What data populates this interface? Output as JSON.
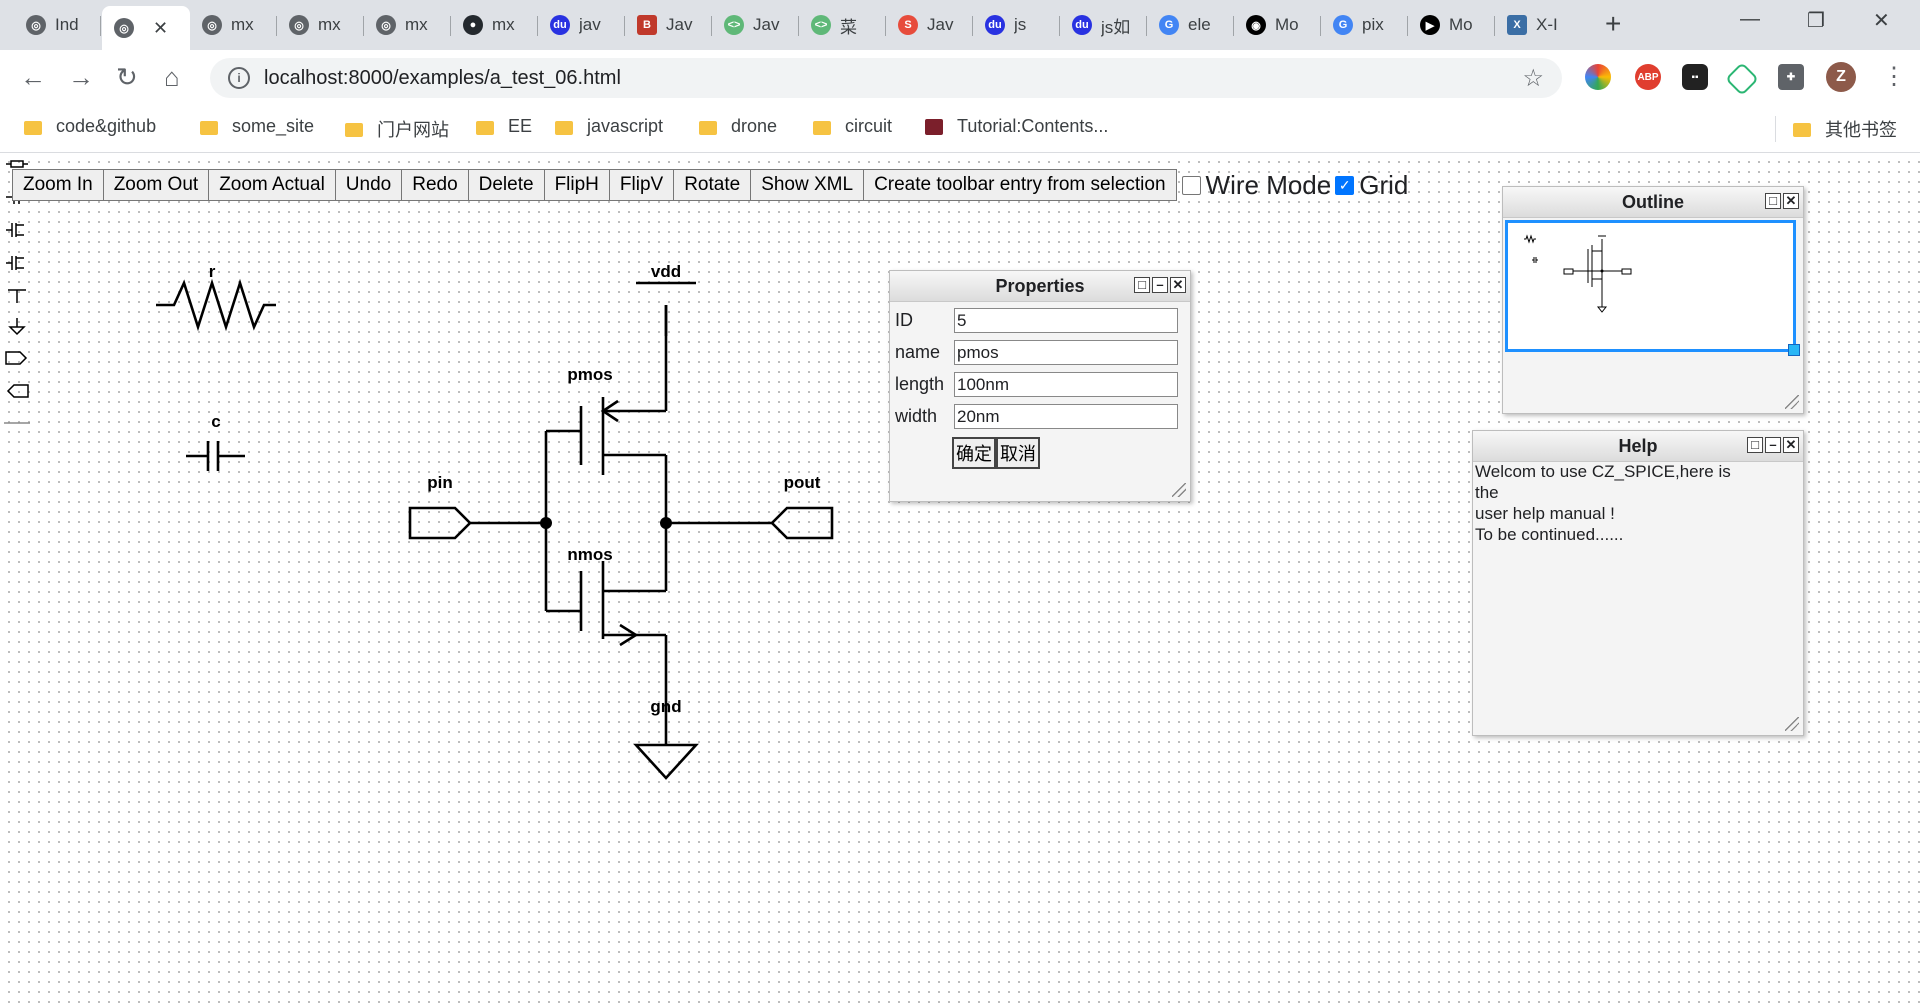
{
  "tabs": [
    {
      "title": "Ind",
      "icon": "globe-icon",
      "color": "#5f6368"
    },
    {
      "title": "",
      "icon": "globe-icon",
      "color": "#5f6368",
      "active": true
    },
    {
      "title": "mx",
      "icon": "globe-icon",
      "color": "#5f6368"
    },
    {
      "title": "mx",
      "icon": "globe-icon",
      "color": "#5f6368"
    },
    {
      "title": "mx",
      "icon": "globe-icon",
      "color": "#5f6368"
    },
    {
      "title": "mx",
      "icon": "github-icon",
      "color": "#24292e"
    },
    {
      "title": "jav",
      "icon": "baidu-icon",
      "color": "#2932e1"
    },
    {
      "title": "Jav",
      "icon": "bilibili-icon",
      "color": "#c0392b"
    },
    {
      "title": "Jav",
      "icon": "runoob-icon",
      "color": "#5fb878"
    },
    {
      "title": "菜",
      "icon": "runoob-icon",
      "color": "#5fb878"
    },
    {
      "title": "Jav",
      "icon": "w3-icon",
      "color": "#e74c3c"
    },
    {
      "title": "js",
      "icon": "baidu-icon",
      "color": "#2932e1"
    },
    {
      "title": "js如",
      "icon": "baidu-icon",
      "color": "#2932e1"
    },
    {
      "title": "ele",
      "icon": "google-icon",
      "color": "#4285f4"
    },
    {
      "title": "Mo",
      "icon": "mozilla-icon",
      "color": "#000000"
    },
    {
      "title": "pix",
      "icon": "google-icon",
      "color": "#4285f4"
    },
    {
      "title": "Mo",
      "icon": "play-icon",
      "color": "#000000"
    },
    {
      "title": "X-I",
      "icon": "x-icon",
      "color": "#3b6ea5"
    }
  ],
  "browser": {
    "url": "localhost:8000/examples/a_test_06.html",
    "profile_initial": "Z",
    "ext_abp": "ABP"
  },
  "bookmarks": [
    {
      "label": "code&github"
    },
    {
      "label": "some_site"
    },
    {
      "label": "门户网站"
    },
    {
      "label": "EE"
    },
    {
      "label": "javascript"
    },
    {
      "label": "drone"
    },
    {
      "label": "circuit"
    },
    {
      "label": "Tutorial:Contents..."
    }
  ],
  "bookmarks_other": "其他书签",
  "toolbar": {
    "buttons": [
      "Zoom In",
      "Zoom Out",
      "Zoom Actual",
      "Undo",
      "Redo",
      "Delete",
      "FlipH",
      "FlipV",
      "Rotate",
      "Show XML",
      "Create toolbar entry from selection"
    ],
    "wire_mode_label": "Wire Mode",
    "wire_mode_checked": false,
    "grid_label": "Grid",
    "grid_checked": true
  },
  "circuit": {
    "labels": {
      "r": "r",
      "c": "c",
      "vdd": "vdd",
      "pmos": "pmos",
      "nmos": "nmos",
      "pin": "pin",
      "pout": "pout",
      "gnd": "gnd"
    }
  },
  "properties": {
    "title": "Properties",
    "rows": [
      {
        "label": "ID",
        "value": "5"
      },
      {
        "label": "name",
        "value": "pmos"
      },
      {
        "label": "length",
        "value": "100nm"
      },
      {
        "label": "width",
        "value": "20nm"
      }
    ],
    "ok": "确定",
    "cancel": "取消"
  },
  "outline": {
    "title": "Outline"
  },
  "help": {
    "title": "Help",
    "lines": [
      "Welcom to use CZ_SPICE,here is the",
      "user help manual !",
      "To be continued......"
    ]
  }
}
